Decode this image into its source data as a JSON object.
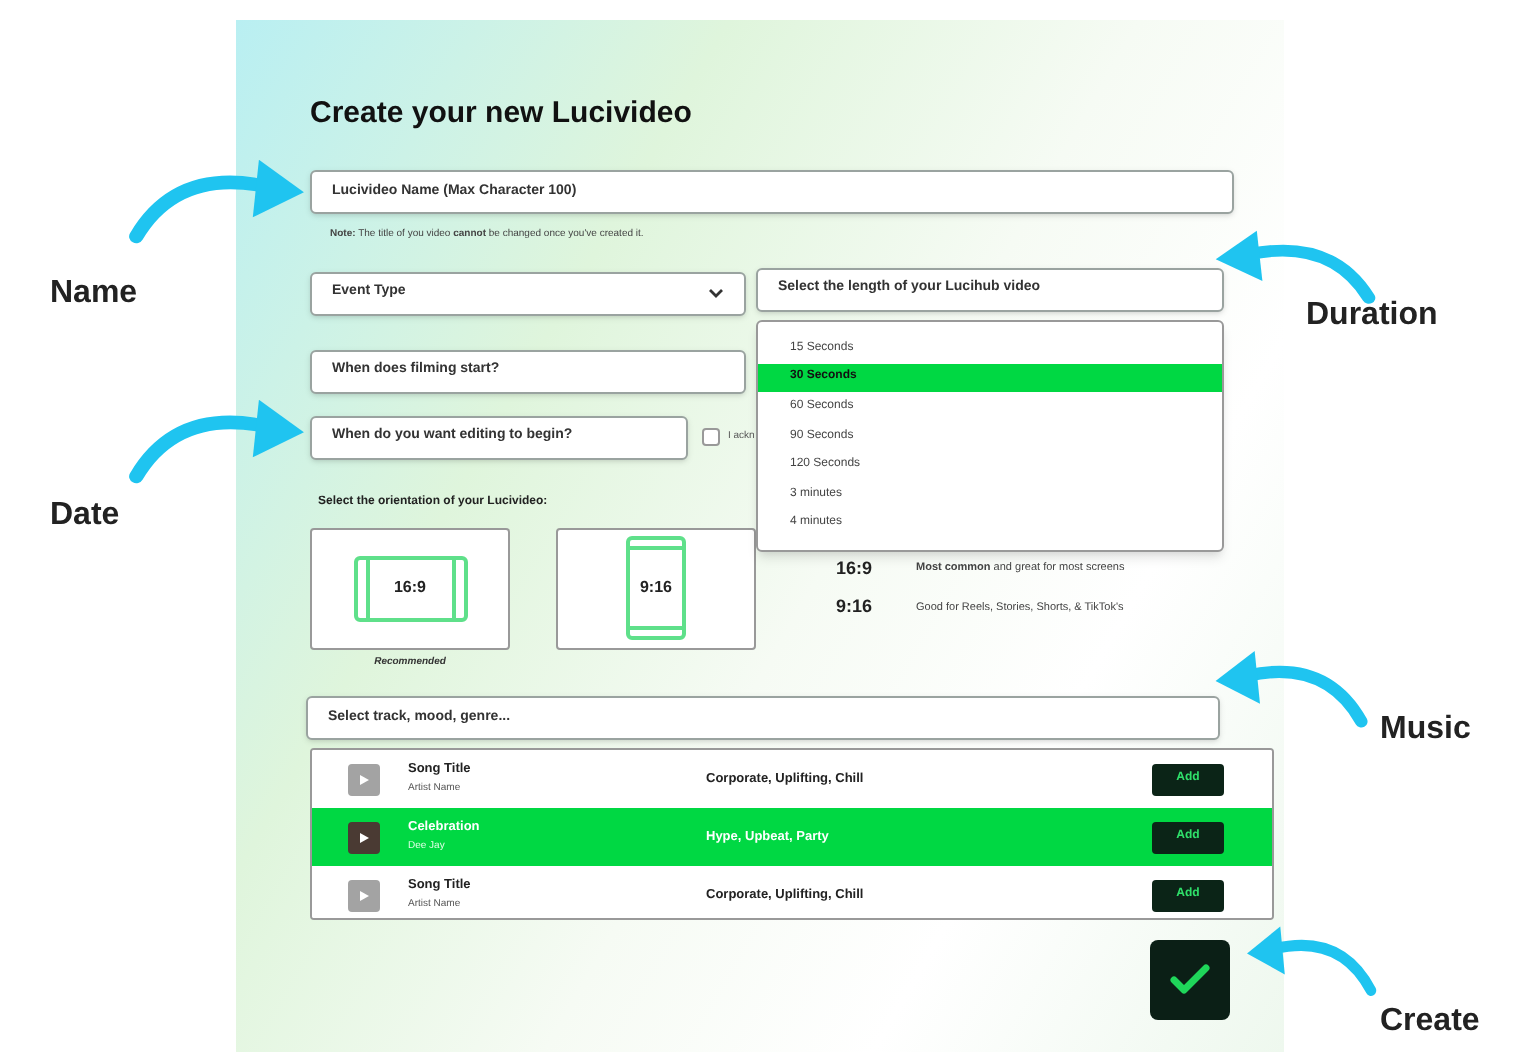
{
  "title": "Create your new Lucivideo",
  "name_field": {
    "placeholder": "Lucivideo Name (Max Character 100)"
  },
  "note": "**Note:** The title of you video **cannot** be changed once you've created it.",
  "event_type": {
    "placeholder": "Event Type"
  },
  "length_select": {
    "placeholder": "Select the length of your Lucihub video",
    "expanded": true,
    "options": [
      {
        "label": "15 Seconds",
        "selected": false
      },
      {
        "label": "30 Seconds",
        "selected": true
      },
      {
        "label": "60 Seconds",
        "selected": false
      },
      {
        "label": "90 Seconds",
        "selected": false
      },
      {
        "label": "120 Seconds",
        "selected": false
      },
      {
        "label": "3 minutes",
        "selected": false
      },
      {
        "label": "4 minutes",
        "selected": false
      }
    ]
  },
  "filming_start": {
    "placeholder": "When does filming start?"
  },
  "editing_begin": {
    "placeholder": "When do you want editing to begin?"
  },
  "acknowledge": {
    "label": "I ackn",
    "checked": false
  },
  "orientation_label": "Select the orientation of your Lucivideo:",
  "orientations": [
    {
      "ratio": "16:9",
      "kind": "landscape",
      "note": "Recommended"
    },
    {
      "ratio": "9:16",
      "kind": "portrait"
    }
  ],
  "orientation_info": [
    {
      "ratio": "16:9",
      "text": "**Most common** and great for most screens"
    },
    {
      "ratio": "9:16",
      "text": "Good for Reels, Stories, Shorts, & TikTok's"
    }
  ],
  "music_search": {
    "placeholder": "Select track, mood, genre..."
  },
  "tracks": [
    {
      "title": "Song Title",
      "artist": "Artist Name",
      "tags": "Corporate, Uplifting, Chill",
      "button": "Add",
      "selected": false,
      "kind": "plain"
    },
    {
      "title": "Celebration",
      "artist": "Dee Jay",
      "tags": "Hype, Upbeat, Party",
      "button": "Add",
      "selected": true,
      "kind": "photo"
    },
    {
      "title": "Song Title",
      "artist": "Artist Name",
      "tags": "Corporate, Uplifting, Chill",
      "button": "Add",
      "selected": false,
      "kind": "plain"
    }
  ],
  "annotations": [
    {
      "label": "Name"
    },
    {
      "label": "Date"
    },
    {
      "label": "Duration"
    },
    {
      "label": "Music"
    },
    {
      "label": "Create"
    }
  ]
}
